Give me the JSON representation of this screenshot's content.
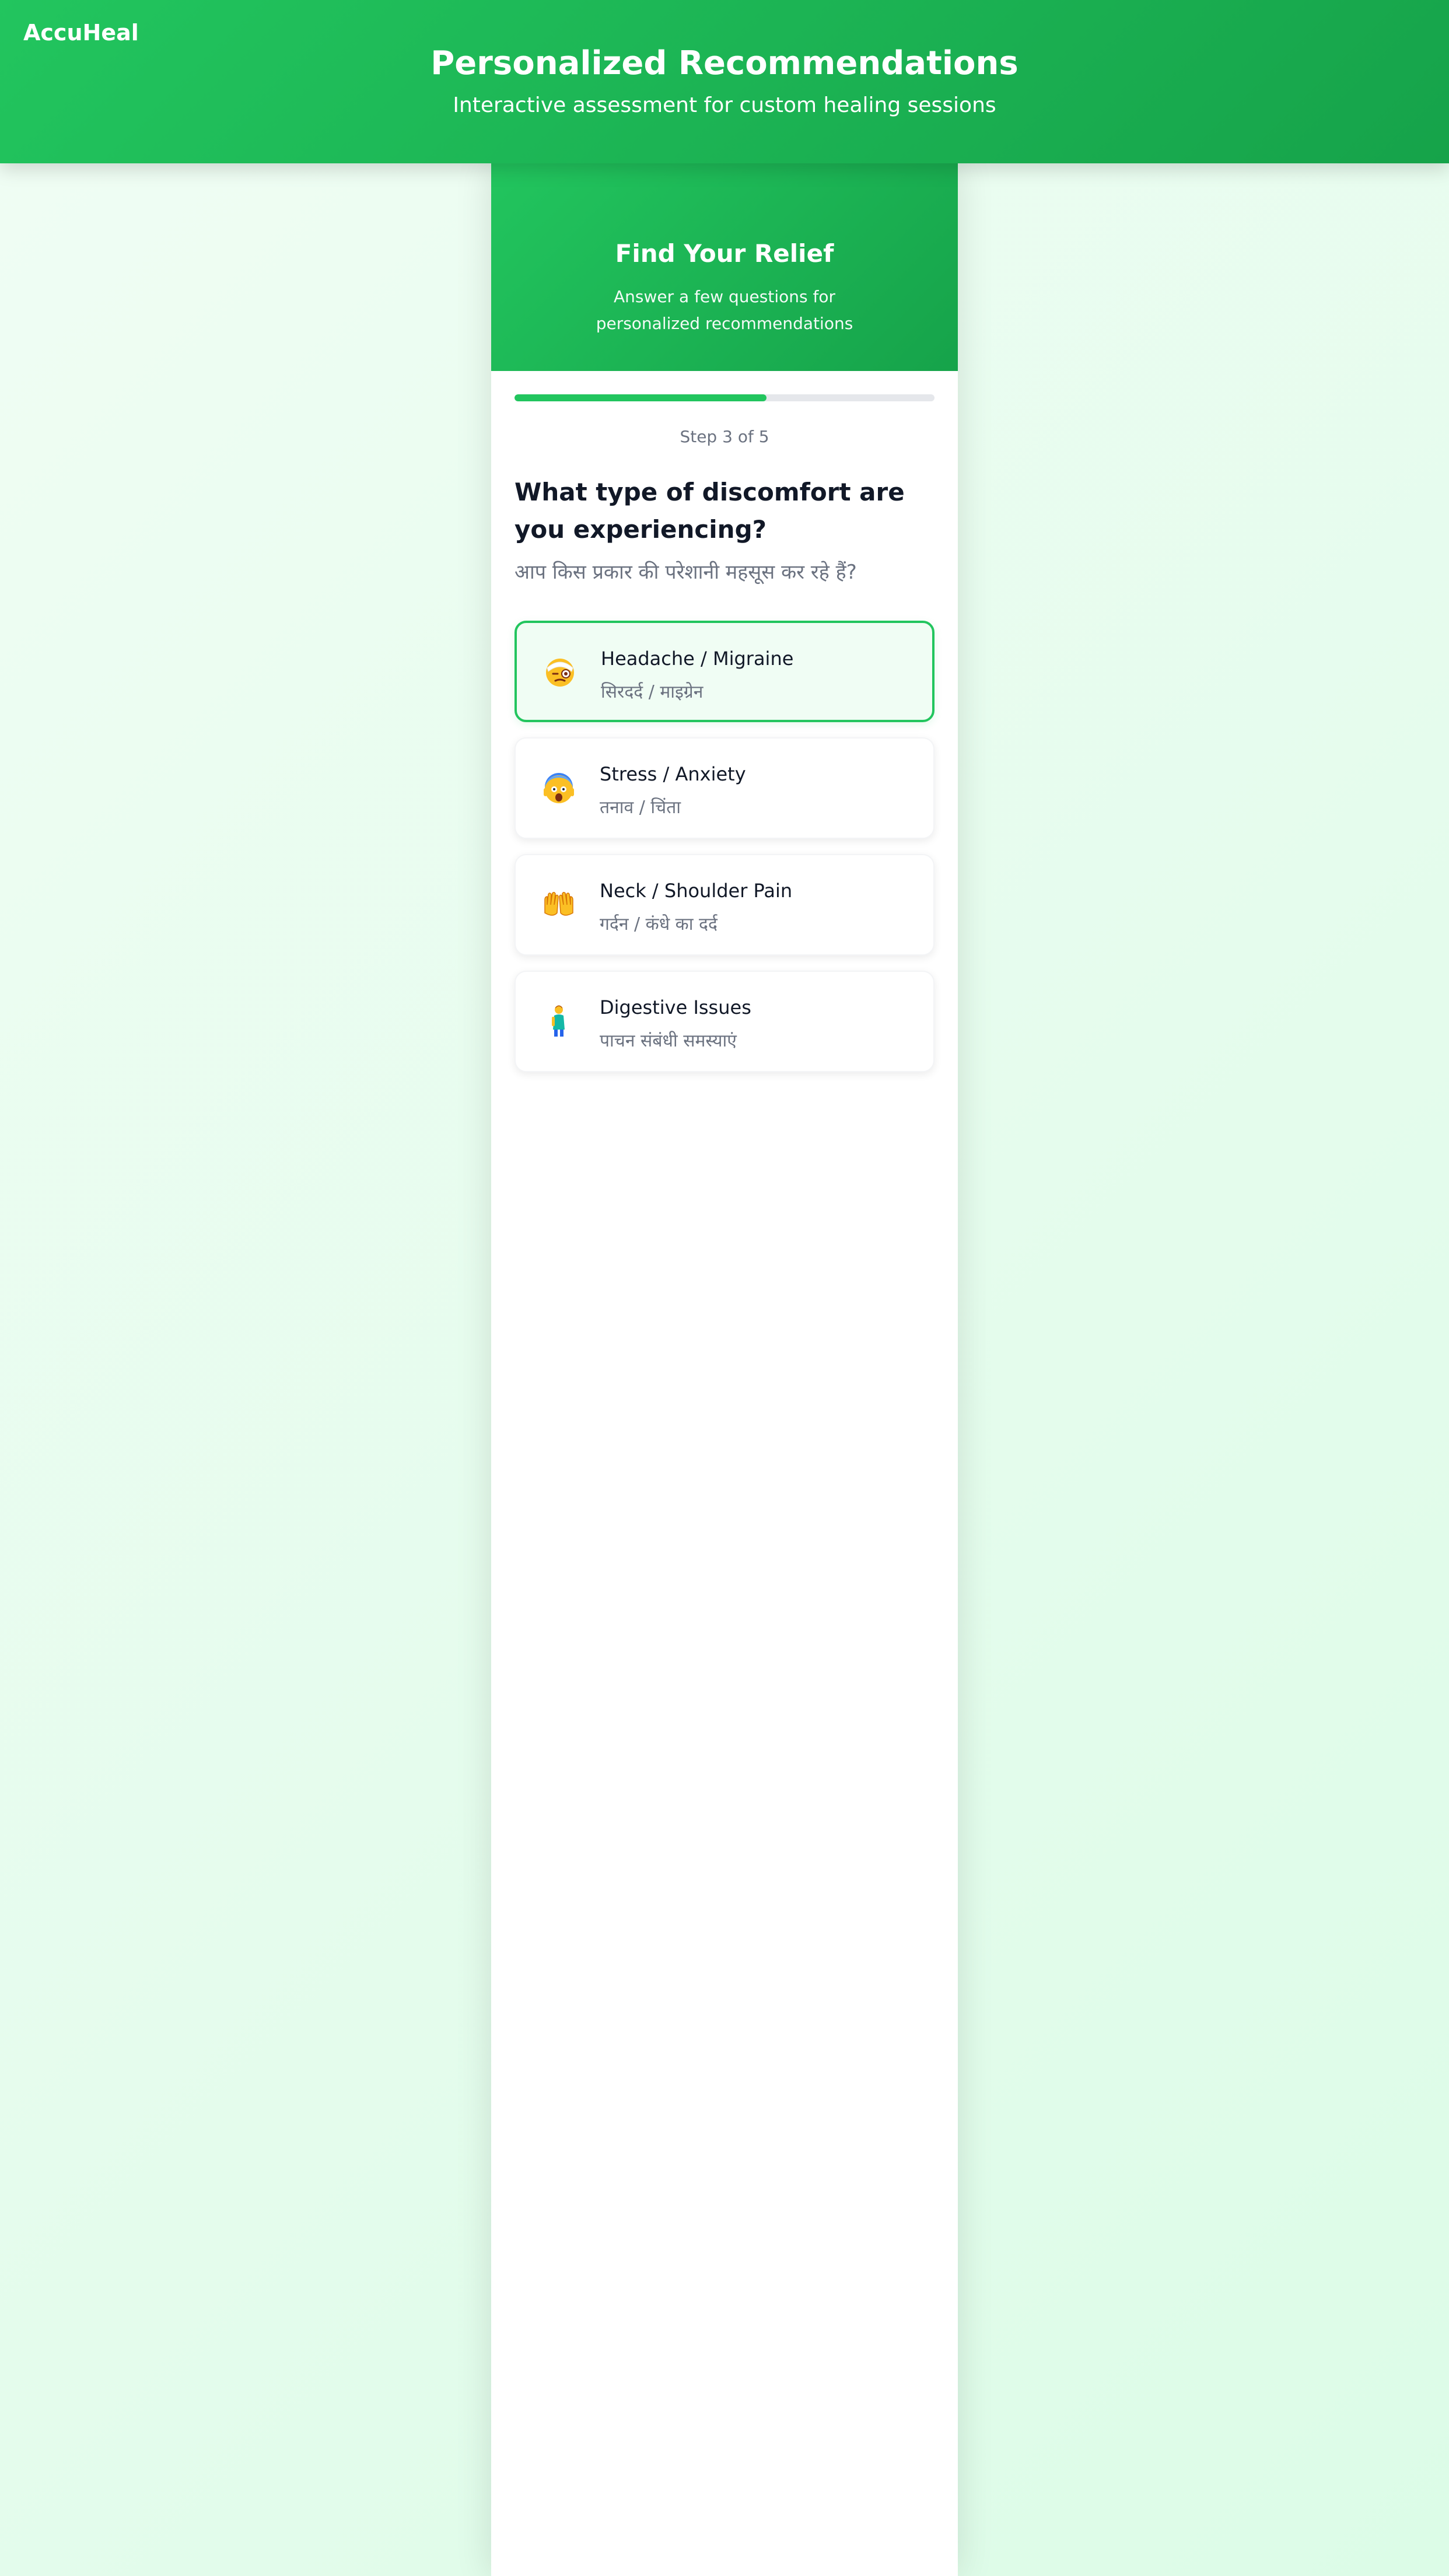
{
  "header": {
    "brand": "AccuHeal",
    "title": "Personalized Recommendations",
    "subtitle": "Interactive assessment for custom healing sessions"
  },
  "panel": {
    "title": "Find Your Relief",
    "description": "Answer a few questions for personalized recommendations"
  },
  "progress": {
    "fraction": 0.6,
    "step_text": "Step 3 of 5"
  },
  "question": {
    "text": "What type of discomfort are you experiencing?",
    "text_hi": "आप किस प्रकार की परेशानी महसूस कर रहे हैं?"
  },
  "options": [
    {
      "label": "Headache / Migraine",
      "label_hi": "सिरदर्द / माइग्रेन",
      "icon": "head-bandage-icon",
      "selected": true
    },
    {
      "label": "Stress / Anxiety",
      "label_hi": "तनाव / चिंता",
      "icon": "screaming-face-icon",
      "selected": false
    },
    {
      "label": "Neck / Shoulder Pain",
      "label_hi": "गर्दन / कंधे का दर्द",
      "icon": "raised-hands-icon",
      "selected": false
    },
    {
      "label": "Digestive Issues",
      "label_hi": "पाचन संबंधी समस्याएं",
      "icon": "standing-person-icon",
      "selected": false
    }
  ],
  "colors": {
    "accent": "#22c55e",
    "accent_dark": "#16a34a",
    "selected_bg": "#f0fdf4",
    "text_primary": "#111827",
    "text_muted": "#6b7280"
  }
}
